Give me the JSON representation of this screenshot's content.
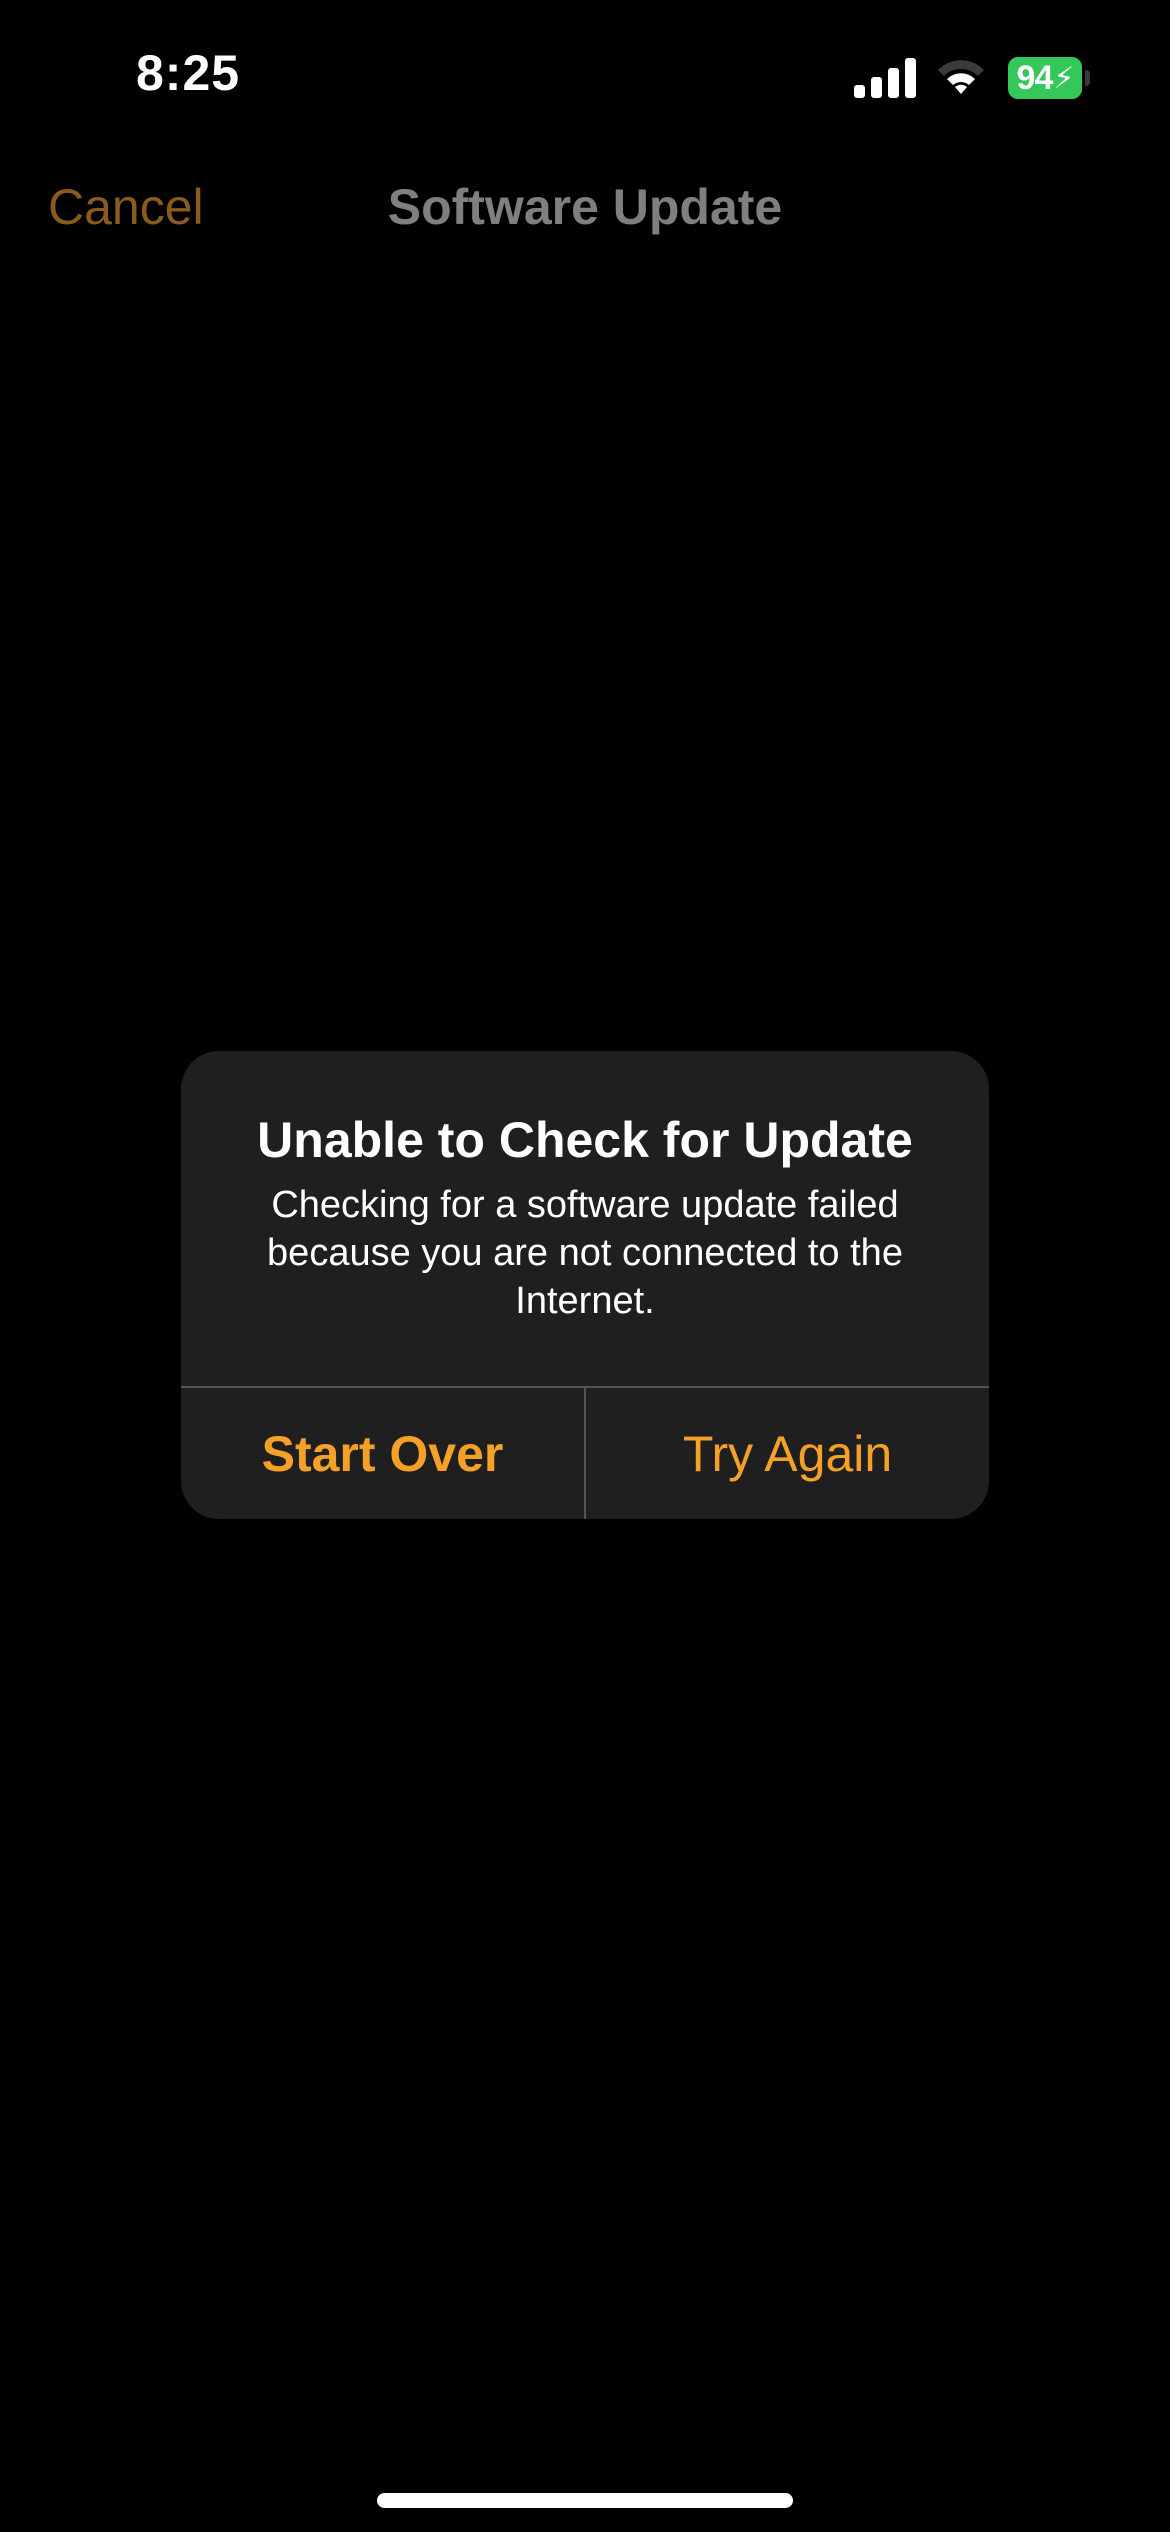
{
  "status_bar": {
    "time": "8:25",
    "signal_icon": "cellular-signal-icon",
    "wifi_icon": "wifi-icon",
    "battery_level": "94",
    "battery_charging": true,
    "battery_color": "#34c759"
  },
  "nav": {
    "cancel_label": "Cancel",
    "title": "Software Update"
  },
  "alert": {
    "title": "Unable to Check for Update",
    "message": "Checking for a software update failed because you are not connected to the Internet.",
    "buttons": [
      {
        "label": "Start Over",
        "style": "bold"
      },
      {
        "label": "Try Again",
        "style": "regular"
      }
    ],
    "accent_color": "#f5a128",
    "background_color": "#1f1f1f"
  }
}
